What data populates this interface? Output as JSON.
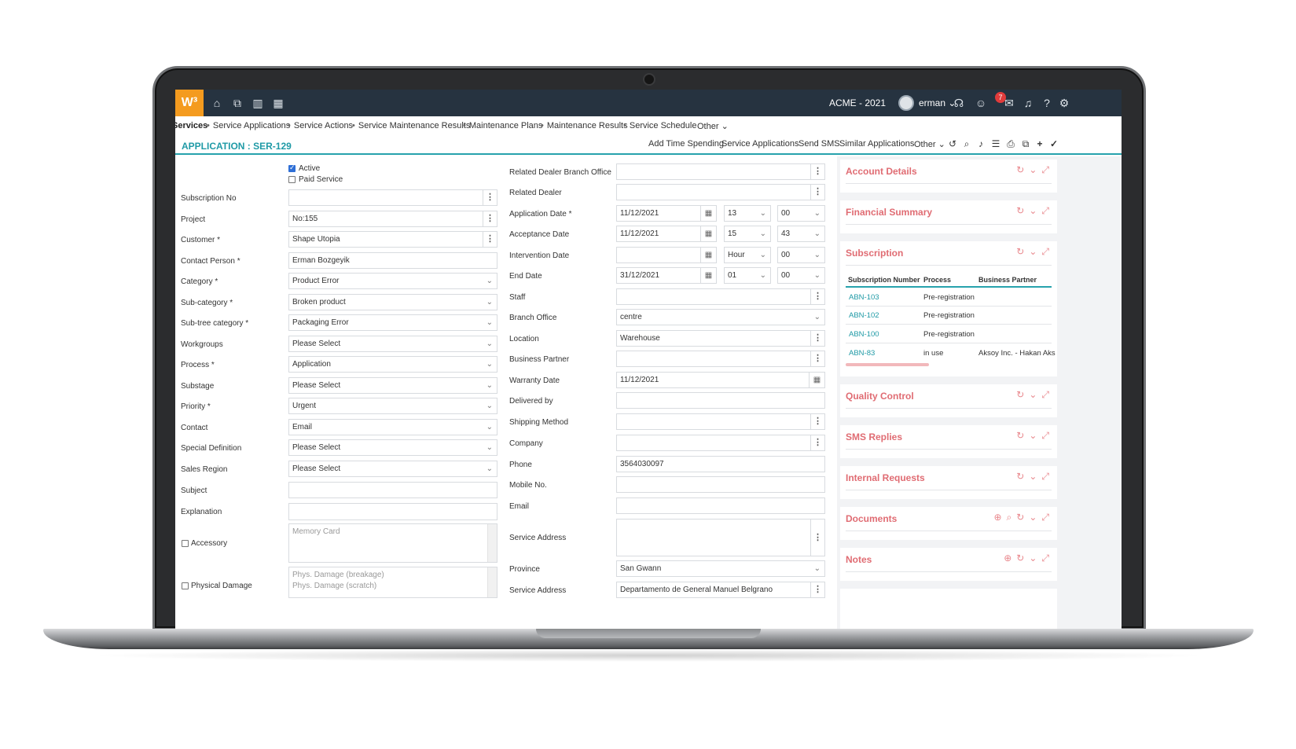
{
  "topbar": {
    "logo": "W³",
    "company": "ACME - 2021",
    "user": "erman",
    "notification_count": "7",
    "icons": [
      "home-icon",
      "box-icon",
      "chart-icon",
      "calendar-icon",
      "headset-icon",
      "emoji-icon",
      "chat-icon",
      "bell-icon",
      "help-icon",
      "gear-icon"
    ]
  },
  "menu": {
    "items": [
      "Services",
      "Service Applications",
      "Service Actions",
      "Service Maintenance Results",
      "Maintenance Plans",
      "Maintenance Results",
      "Service Schedule",
      "Other"
    ]
  },
  "header": {
    "title": "APPLICATION : SER-129",
    "actions": [
      "Add Time Spending",
      "Service Applications",
      "Send SMS",
      "Similar Applications",
      "Other"
    ]
  },
  "left_form": {
    "active_label": "Active",
    "paid_label": "Paid Service",
    "fields": [
      {
        "label": "Subscription No",
        "value": ""
      },
      {
        "label": "Project",
        "value": "No:155"
      },
      {
        "label": "Customer *",
        "value": "Shape Utopia"
      },
      {
        "label": "Contact Person *",
        "value": "Erman Bozgeyik"
      },
      {
        "label": "Category *",
        "value": "Product Error"
      },
      {
        "label": "Sub-category *",
        "value": "Broken product"
      },
      {
        "label": "Sub-tree category *",
        "value": "Packaging Error"
      },
      {
        "label": "Workgroups",
        "value": "Please Select"
      },
      {
        "label": "Process *",
        "value": "Application"
      },
      {
        "label": "Substage",
        "value": "Please Select"
      },
      {
        "label": "Priority *",
        "value": "Urgent"
      },
      {
        "label": "Contact",
        "value": "Email"
      },
      {
        "label": "Special Definition",
        "value": "Please Select"
      },
      {
        "label": "Sales Region",
        "value": "Please Select"
      },
      {
        "label": "Subject",
        "value": ""
      },
      {
        "label": "Explanation",
        "value": ""
      }
    ],
    "accessory_label": "Accessory",
    "accessory_placeholder": "Memory Card",
    "physical_label": "Physical Damage",
    "physical_options": [
      "Phys. Damage (breakage)",
      "Phys. Damage (scratch)"
    ]
  },
  "middle_form": {
    "fields": [
      {
        "label": "Related Dealer Branch Office",
        "value": ""
      },
      {
        "label": "Related Dealer",
        "value": ""
      },
      {
        "label": "Application Date *",
        "value": "11/12/2021",
        "hour": "13",
        "minute": "00"
      },
      {
        "label": "Acceptance Date",
        "value": "11/12/2021",
        "hour": "15",
        "minute": "43"
      },
      {
        "label": "Intervention Date",
        "value": "",
        "hour": "Hour",
        "minute": "00"
      },
      {
        "label": "End Date",
        "value": "31/12/2021",
        "hour": "01",
        "minute": "00"
      },
      {
        "label": "Staff",
        "value": ""
      },
      {
        "label": "Branch Office",
        "value": "centre"
      },
      {
        "label": "Location",
        "value": "Warehouse"
      },
      {
        "label": "Business Partner",
        "value": ""
      },
      {
        "label": "Warranty Date",
        "value": "11/12/2021"
      },
      {
        "label": "Delivered by",
        "value": ""
      },
      {
        "label": "Shipping Method",
        "value": ""
      },
      {
        "label": "Company",
        "value": ""
      },
      {
        "label": "Phone",
        "value": "3564030097"
      },
      {
        "label": "Mobile No.",
        "value": ""
      },
      {
        "label": "Email",
        "value": ""
      },
      {
        "label": "Service Address",
        "value": ""
      },
      {
        "label": "Province",
        "value": "San Gwann"
      },
      {
        "label": "Service Address",
        "value": "Departamento de General Manuel Belgrano"
      }
    ]
  },
  "widgets": {
    "account": "Account Details",
    "financial": "Financial Summary",
    "subscription": "Subscription",
    "subscription_cols": [
      "Subscription Number",
      "Process",
      "Business Partner"
    ],
    "subscription_rows": [
      {
        "number": "ABN-103",
        "process": "Pre-registration",
        "partner": ""
      },
      {
        "number": "ABN-102",
        "process": "Pre-registration",
        "partner": ""
      },
      {
        "number": "ABN-100",
        "process": "Pre-registration",
        "partner": ""
      },
      {
        "number": "ABN-83",
        "process": "in use",
        "partner": "Aksoy Inc. - Hakan Aks"
      }
    ],
    "quality": "Quality Control",
    "sms": "SMS Replies",
    "internal": "Internal Requests",
    "documents": "Documents",
    "notes": "Notes"
  }
}
